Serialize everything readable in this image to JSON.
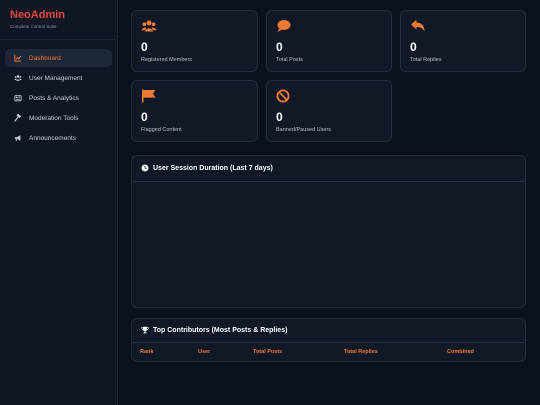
{
  "brand": {
    "name": "NeoAdmin",
    "subtitle": "Complete Control Suite"
  },
  "sidebar": {
    "items": [
      {
        "label": "Dashboard",
        "icon": "chart-line-icon",
        "active": true
      },
      {
        "label": "User Management",
        "icon": "users-icon",
        "active": false
      },
      {
        "label": "Posts & Analytics",
        "icon": "newspaper-icon",
        "active": false
      },
      {
        "label": "Moderation Tools",
        "icon": "hammer-icon",
        "active": false
      },
      {
        "label": "Announcements",
        "icon": "bullhorn-icon",
        "active": false
      }
    ]
  },
  "stats": [
    {
      "value": "0",
      "label": "Registered Members",
      "icon": "users-icon"
    },
    {
      "value": "0",
      "label": "Total Posts",
      "icon": "comment-icon"
    },
    {
      "value": "0",
      "label": "Total Replies",
      "icon": "reply-icon"
    },
    {
      "value": "0",
      "label": "Flagged Content",
      "icon": "flag-icon"
    },
    {
      "value": "0",
      "label": "Banned/Paused Users",
      "icon": "ban-icon"
    }
  ],
  "session_panel": {
    "title": "User Session Duration (Last 7 days)",
    "icon": "clock-icon"
  },
  "contributors": {
    "title": "Top Contributors (Most Posts & Replies)",
    "icon": "trophy-icon",
    "columns": [
      "Rank",
      "User",
      "Total Posts",
      "Total Replies",
      "Combined"
    ]
  },
  "colors": {
    "accent": "#f07a33",
    "brand": "#e8463c",
    "background": "#0b111d",
    "card": "#111927"
  }
}
